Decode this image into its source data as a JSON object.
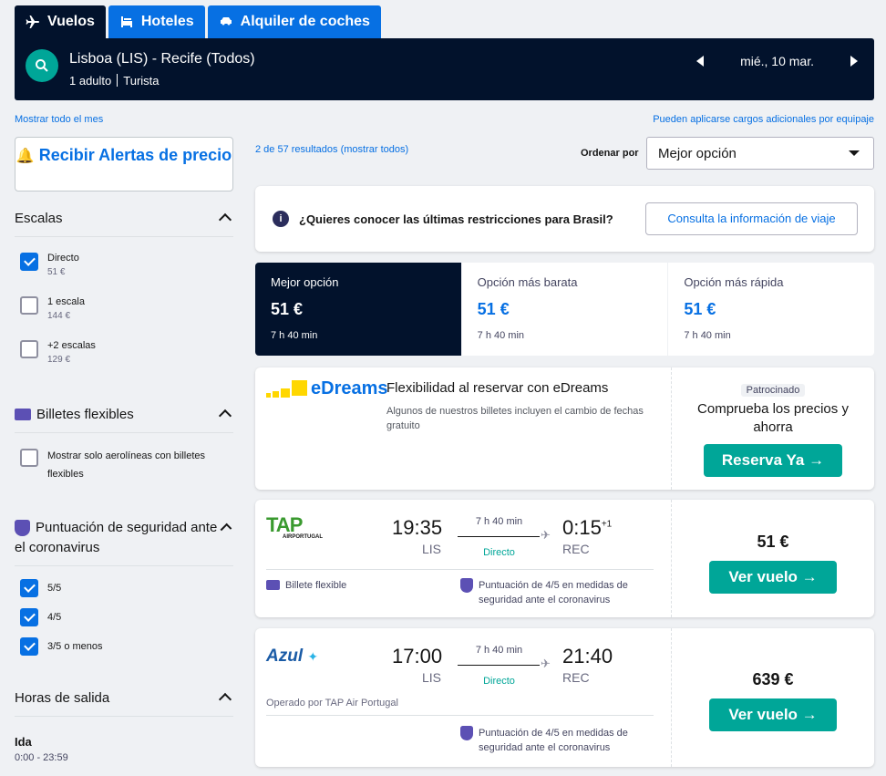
{
  "tabs": [
    {
      "label": "Vuelos",
      "icon": "plane-icon",
      "active": true
    },
    {
      "label": "Hoteles",
      "icon": "bed-icon",
      "active": false
    },
    {
      "label": "Alquiler de coches",
      "icon": "car-icon",
      "active": false
    }
  ],
  "search": {
    "route": "Lisboa (LIS) - Recife (Todos)",
    "passengers": "1 adulto",
    "cabin": "Turista",
    "date": "mié., 10 mar."
  },
  "links": {
    "show_month": "Mostrar todo el mes",
    "baggage_fees": "Pueden aplicarse cargos adicionales por equipaje",
    "results": "2 de 57 resultados (mostrar todos)"
  },
  "sidebar": {
    "alert_button": "Recibir Alertas de precio",
    "stops": {
      "title": "Escalas",
      "options": [
        {
          "label": "Directo",
          "price": "51 €",
          "checked": true
        },
        {
          "label": "1 escala",
          "price": "144 €",
          "checked": false
        },
        {
          "label": "+2 escalas",
          "price": "129 €",
          "checked": false
        }
      ]
    },
    "flexible": {
      "title": "Billetes flexibles",
      "option": "Mostrar solo aerolíneas con billetes flexibles"
    },
    "covid": {
      "title": "Puntuación de seguridad ante el coronavirus",
      "options": [
        {
          "label": "5/5",
          "checked": true
        },
        {
          "label": "4/5",
          "checked": true
        },
        {
          "label": "3/5 o menos",
          "checked": true
        }
      ]
    },
    "departure": {
      "title": "Horas de salida",
      "leg": "Ida",
      "range": "0:00 - 23:59"
    }
  },
  "sort": {
    "label": "Ordenar por",
    "selected": "Mejor opción"
  },
  "notice": {
    "text": "¿Quieres conocer las últimas restricciones para Brasil?",
    "button": "Consulta la información de viaje"
  },
  "sort_tabs": [
    {
      "title": "Mejor opción",
      "price": "51 €",
      "duration": "7 h 40 min",
      "active": true
    },
    {
      "title": "Opción más barata",
      "price": "51 €",
      "duration": "7 h 40 min",
      "active": false
    },
    {
      "title": "Opción más rápida",
      "price": "51 €",
      "duration": "7 h 40 min",
      "active": false
    }
  ],
  "ad": {
    "logo": "eDreams",
    "title": "Flexibilidad al reservar con eDreams",
    "subtitle": "Algunos de nuestros billetes incluyen el cambio de fechas gratuito",
    "sponsored": "Patrocinado",
    "cta_text": "Comprueba los precios y ahorra",
    "button": "Reserva Ya →"
  },
  "flights": [
    {
      "airline": "TAP",
      "airline_sub": "AIRPORTUGAL",
      "dep_time": "19:35",
      "dep_airport": "LIS",
      "duration": "7 h 40 min",
      "stops": "Directo",
      "arr_time": "0:15",
      "arr_offset": "+1",
      "arr_airport": "REC",
      "flex_tag": "Billete flexible",
      "safety_tag": "Puntuación de 4/5 en medidas de seguridad ante el coronavirus",
      "price": "51 €",
      "button": "Ver vuelo →"
    },
    {
      "airline": "Azul",
      "dep_time": "17:00",
      "dep_airport": "LIS",
      "duration": "7 h 40 min",
      "stops": "Directo",
      "arr_time": "21:40",
      "arr_airport": "REC",
      "operated_by": "Operado por TAP Air Portugal",
      "safety_tag": "Puntuación de 4/5 en medidas de seguridad ante el coronavirus",
      "price": "639 €",
      "button": "Ver vuelo →"
    }
  ],
  "colors": {
    "navy": "#02122c",
    "blue": "#0770e3",
    "teal": "#00a698",
    "purple": "#5c50b4"
  }
}
